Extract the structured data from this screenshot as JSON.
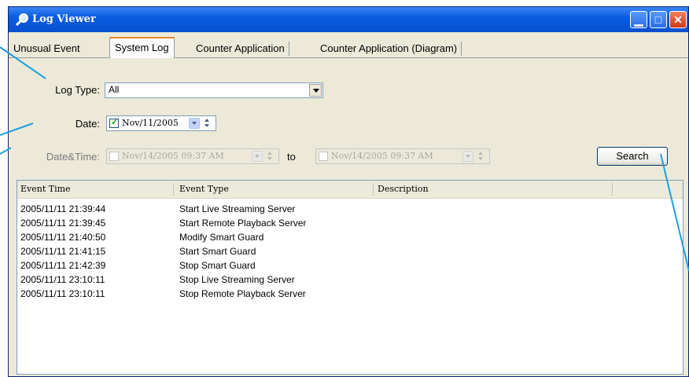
{
  "window": {
    "title": "Log Viewer",
    "buttons": [
      "minimize",
      "maximize",
      "close"
    ]
  },
  "tabs": [
    {
      "label": "Unusual Event",
      "active": false
    },
    {
      "label": "System Log",
      "active": true
    },
    {
      "label": "Counter Application",
      "active": false
    },
    {
      "label": "Counter Application (Diagram)",
      "active": false
    }
  ],
  "filters": {
    "log_type_label": "Log Type:",
    "log_type_value": "All",
    "date_label": "Date:",
    "date_value": "Nov/11/2005",
    "date_checked": true,
    "datetime_label": "Date&Time:",
    "datetime_from": "Nov/14/2005 09:37 AM",
    "datetime_to_label": "to",
    "datetime_to": "Nov/14/2005 09:37 AM",
    "search_label": "Search"
  },
  "table": {
    "columns": [
      "Event Time",
      "Event Type",
      "Description"
    ],
    "rows": [
      {
        "time": "2005/11/11 21:39:44",
        "type": "Start Live Streaming Server",
        "description": ""
      },
      {
        "time": "2005/11/11 21:39:45",
        "type": "Start Remote Playback Server",
        "description": ""
      },
      {
        "time": "2005/11/11 21:40:50",
        "type": "Modify Smart Guard",
        "description": ""
      },
      {
        "time": "2005/11/11 21:41:15",
        "type": "Start Smart Guard",
        "description": ""
      },
      {
        "time": "2005/11/11 21:42:39",
        "type": "Stop Smart Guard",
        "description": ""
      },
      {
        "time": "2005/11/11 23:10:11",
        "type": "Stop Live Streaming Server",
        "description": ""
      },
      {
        "time": "2005/11/11 23:10:11",
        "type": "Stop Remote Playback Server",
        "description": ""
      }
    ]
  },
  "colors": {
    "titlebar": "#0a5ce0",
    "window_bg": "#ece9d8",
    "active_tab_accent": "#e68b2c",
    "callout_line": "#1e9fe0"
  }
}
